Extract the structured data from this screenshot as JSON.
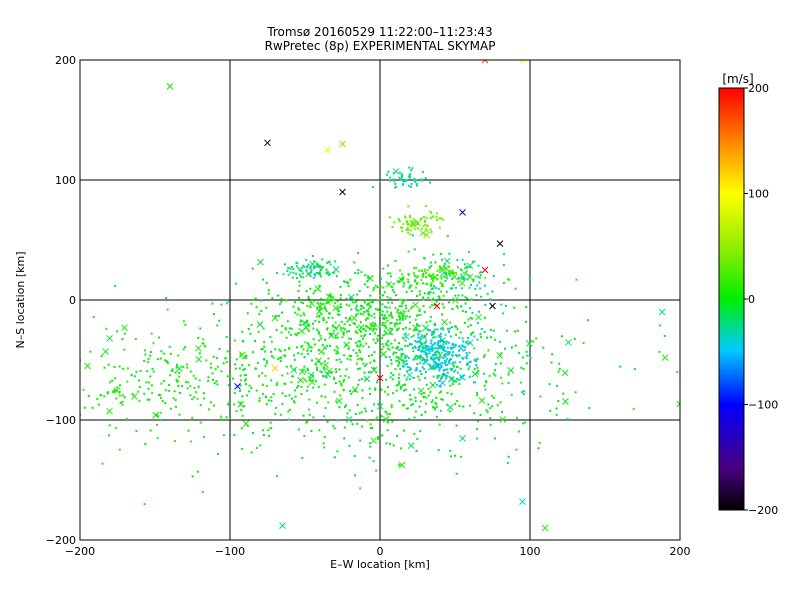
{
  "chart_data": {
    "type": "scatter",
    "title": "Tromsø 20160529 11:22:00–11:23:43",
    "subtitle": "RwPretec (8p) EXPERIMENTAL SKYMAP",
    "xlabel": "E–W location [km]",
    "ylabel": "N–S location [km]",
    "xlim": [
      -200,
      200
    ],
    "ylim": [
      -200,
      200
    ],
    "x_ticks": [
      -200,
      -100,
      0,
      100,
      200
    ],
    "y_ticks": [
      -200,
      -100,
      0,
      100,
      200
    ],
    "x_tick_labels": [
      "−200",
      "−100",
      "0",
      "100",
      "200"
    ],
    "y_tick_labels": [
      "−200",
      "−100",
      "0",
      "100",
      "200"
    ],
    "grid": true,
    "colorbar": {
      "label": "[m/s]",
      "range": [
        -200,
        200
      ],
      "ticks": [
        200,
        100,
        0,
        -100,
        -200
      ],
      "tick_labels": [
        "200",
        "100",
        "0",
        "−100",
        "−200"
      ],
      "colormap": "rainbow (black → purple → blue → cyan → green → yellow → orange → red)"
    },
    "clusters": [
      {
        "center": [
          0,
          -55
        ],
        "spread": [
          60,
          35
        ],
        "count": 900,
        "velocity_range": [
          -20,
          15
        ]
      },
      {
        "center": [
          -140,
          -70
        ],
        "spread": [
          45,
          25
        ],
        "count": 250,
        "velocity_range": [
          -10,
          20
        ]
      },
      {
        "center": [
          40,
          -45
        ],
        "spread": [
          12,
          10
        ],
        "count": 300,
        "velocity_range": [
          -60,
          -30
        ]
      },
      {
        "center": [
          -45,
          25
        ],
        "spread": [
          10,
          4
        ],
        "count": 80,
        "velocity_range": [
          -35,
          -10
        ]
      },
      {
        "center": [
          20,
          100
        ],
        "spread": [
          8,
          4
        ],
        "count": 50,
        "velocity_range": [
          -40,
          -20
        ]
      },
      {
        "center": [
          25,
          65
        ],
        "spread": [
          8,
          5
        ],
        "count": 70,
        "velocity_range": [
          25,
          45
        ]
      },
      {
        "center": [
          40,
          20
        ],
        "spread": [
          12,
          5
        ],
        "count": 100,
        "velocity_range": [
          15,
          30
        ]
      },
      {
        "center": [
          5,
          0
        ],
        "spread": [
          30,
          15
        ],
        "count": 200,
        "velocity_range": [
          -20,
          20
        ]
      },
      {
        "center": [
          -20,
          -20
        ],
        "spread": [
          30,
          15
        ],
        "count": 200,
        "velocity_range": [
          -5,
          15
        ]
      },
      {
        "center": [
          55,
          15
        ],
        "spread": [
          15,
          15
        ],
        "count": 60,
        "velocity_range": [
          -40,
          -15
        ]
      }
    ],
    "outliers": [
      {
        "x": -75,
        "y": 131,
        "v": -200
      },
      {
        "x": -25,
        "y": 90,
        "v": -200
      },
      {
        "x": 55,
        "y": 73,
        "v": -110
      },
      {
        "x": 80,
        "y": 47,
        "v": -200
      },
      {
        "x": 70,
        "y": 25,
        "v": 200
      },
      {
        "x": 38,
        "y": -5,
        "v": 200
      },
      {
        "x": 75,
        "y": -5,
        "v": -200
      },
      {
        "x": 0,
        "y": -65,
        "v": 200
      },
      {
        "x": -40,
        "y": -5,
        "v": 5
      },
      {
        "x": -95,
        "y": -72,
        "v": -110
      },
      {
        "x": -70,
        "y": -57,
        "v": 120
      },
      {
        "x": -35,
        "y": 125,
        "v": 90
      },
      {
        "x": -25,
        "y": 130,
        "v": 40
      },
      {
        "x": 95,
        "y": 200,
        "v": 100
      },
      {
        "x": 70,
        "y": 200,
        "v": 180
      },
      {
        "x": 188,
        "y": -10,
        "v": -30
      },
      {
        "x": 190,
        "y": -48,
        "v": 10
      },
      {
        "x": 95,
        "y": -168,
        "v": -40
      },
      {
        "x": 110,
        "y": -190,
        "v": 10
      },
      {
        "x": -195,
        "y": -55,
        "v": 10
      },
      {
        "x": -140,
        "y": 178,
        "v": 10
      },
      {
        "x": -65,
        "y": -188,
        "v": -30
      }
    ]
  }
}
